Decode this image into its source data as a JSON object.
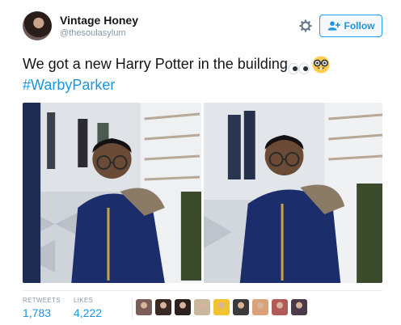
{
  "user": {
    "name": "Vintage Honey",
    "handle": "@thesoulasylum"
  },
  "header": {
    "settings_icon": "gear-icon",
    "follow_label": "Follow",
    "follow_icon": "add-user-icon"
  },
  "tweet": {
    "text": "We got a new Harry Potter in the building",
    "emojis": [
      "eyes-emoji",
      "nerd-face-emoji"
    ],
    "hashtag": "#WarbyParker"
  },
  "stats": {
    "retweets_label": "RETWEETS",
    "retweets_value": "1,783",
    "likes_label": "LIKES",
    "likes_value": "4,222"
  },
  "colors": {
    "accent": "#1b95e0",
    "muted": "#8899a6",
    "text": "#14171a"
  },
  "likers": [
    {
      "color": "#7a5c58"
    },
    {
      "color": "#3a2a25"
    },
    {
      "color": "#2b2220"
    },
    {
      "color": "#c9b7a0"
    },
    {
      "color": "#f2c230"
    },
    {
      "color": "#3b3b3b"
    },
    {
      "color": "#d9a27a"
    },
    {
      "color": "#b05a5a"
    },
    {
      "color": "#4a3a4a"
    }
  ]
}
